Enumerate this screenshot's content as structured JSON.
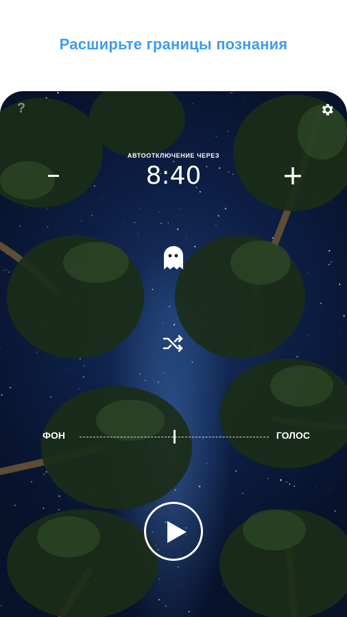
{
  "promo": {
    "headline": "Расширьте границы познания"
  },
  "player": {
    "help_label": "?",
    "timer": {
      "label": "АВТООТКЛЮЧЕНИЕ ЧЕРЕЗ",
      "value": "8:40"
    },
    "mix": {
      "left_label": "ФОН",
      "right_label": "ГОЛОС",
      "balance": 0.5
    },
    "icons": {
      "help": "question-icon",
      "settings": "gear-icon",
      "decrease": "minus-icon",
      "increase": "plus-icon",
      "mode": "ghost-icon",
      "shuffle": "shuffle-icon",
      "play": "play-icon"
    },
    "colors": {
      "headline": "#3d9cf0",
      "sky_top": "#1a3566",
      "sky_edge": "#07122b",
      "foreground": "#ffffff"
    }
  }
}
